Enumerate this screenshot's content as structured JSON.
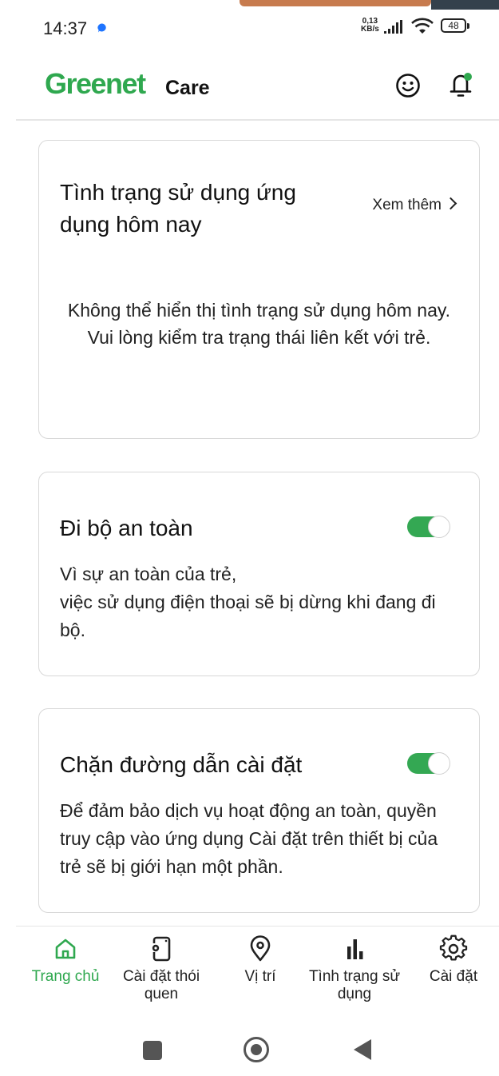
{
  "status_bar": {
    "time": "14:37",
    "net_speed_value": "0,13",
    "net_speed_unit": "KB/s",
    "battery": "48"
  },
  "header": {
    "logo": "Greenet",
    "logo_sub": "Care"
  },
  "card_usage": {
    "title": "Tình trạng sử dụng ứng dụng hôm nay",
    "see_more": "Xem thêm",
    "empty_line1": "Không thể hiển thị tình trạng sử dụng hôm nay.",
    "empty_line2": "Vui lòng kiểm tra trạng thái liên kết với trẻ."
  },
  "card_walk": {
    "title": "Đi bộ an toàn",
    "desc_line1": "Vì sự an toàn của trẻ,",
    "desc_line2": "việc sử dụng điện thoại sẽ bị dừng khi đang đi bộ.",
    "enabled": true
  },
  "card_block": {
    "title": "Chặn đường dẫn cài đặt",
    "desc": "Để đảm bảo dịch vụ hoạt động an toàn, quyền truy cập vào ứng dụng Cài đặt trên thiết bị của trẻ sẽ bị giới hạn một phần.",
    "enabled": true
  },
  "bottom_nav": {
    "home": "Trang chủ",
    "routine": "Cài đặt thói quen",
    "location": "Vị trí",
    "usage": "Tình trạng sử dụng",
    "settings": "Cài đặt",
    "active": "home"
  },
  "colors": {
    "brand_green": "#2fa84f",
    "toggle_on": "#34a853"
  }
}
